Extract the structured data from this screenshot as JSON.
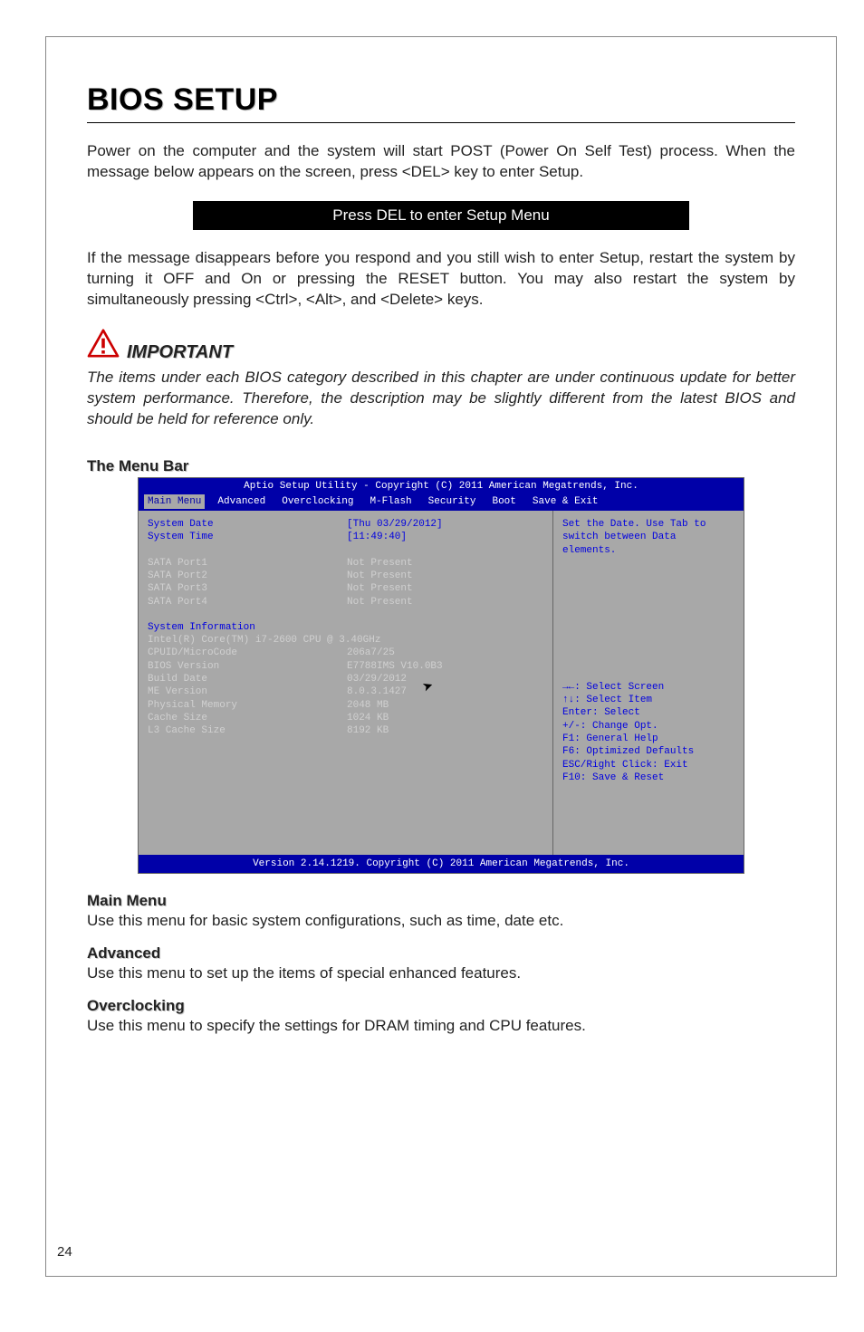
{
  "title": "BIOS SETUP",
  "intro1": "Power on the computer and the system will start POST (Power On Self Test) process. When the message below appears on the screen, press <DEL> key to enter Setup.",
  "delmsg": "Press DEL to enter Setup Menu",
  "intro2": "If the message disappears before you respond and you still wish to enter Setup, restart the system by turning it OFF and On or pressing the RESET button. You may also restart the system by simultaneously pressing <Ctrl>, <Alt>, and <Delete> keys.",
  "important_label": "IMPORTANT",
  "important_text": "The items under each BIOS category described in this chapter are under continuous update for better system performance. Therefore, the description may be slightly different from the latest BIOS and should be held for reference only.",
  "menu_bar_heading": "The Menu Bar",
  "bios": {
    "header_line": "Aptio Setup Utility - Copyright (C) 2011 American Megatrends, Inc.",
    "tabs": [
      "Main Menu",
      "Advanced",
      "Overclocking",
      "M-Flash",
      "Security",
      "Boot",
      "Save & Exit"
    ],
    "rows_top": [
      {
        "label": "System Date",
        "value": "[Thu 03/29/2012]",
        "sel": true
      },
      {
        "label": "System Time",
        "value": "[11:49:40]",
        "sel": true
      }
    ],
    "rows_sata": [
      {
        "label": "SATA Port1",
        "value": "Not Present"
      },
      {
        "label": "SATA Port2",
        "value": "Not Present"
      },
      {
        "label": "SATA Port3",
        "value": "Not Present"
      },
      {
        "label": "SATA Port4",
        "value": "Not Present"
      }
    ],
    "sysinfo_heading": "System Information",
    "cpu_line": "Intel(R) Core(TM) i7-2600 CPU @ 3.40GHz",
    "rows_info": [
      {
        "label": "CPUID/MicroCode",
        "value": "206a7/25"
      },
      {
        "label": "BIOS Version",
        "value": "E7788IMS V10.0B3"
      },
      {
        "label": "Build Date",
        "value": "03/29/2012"
      },
      {
        "label": "ME Version",
        "value": "8.0.3.1427"
      },
      {
        "label": "Physical Memory",
        "value": "2048 MB"
      },
      {
        "label": "Cache Size",
        "value": "1024 KB"
      },
      {
        "label": "L3 Cache Size",
        "value": "8192 KB"
      }
    ],
    "help_top": "Set the Date. Use Tab to switch between Data elements.",
    "help_keys": [
      "→←: Select Screen",
      "↑↓: Select Item",
      "Enter: Select",
      "+/-: Change Opt.",
      "F1: General Help",
      "F6: Optimized Defaults",
      "ESC/Right Click: Exit",
      "F10: Save & Reset"
    ],
    "footer": "Version 2.14.1219. Copyright (C) 2011 American Megatrends, Inc."
  },
  "sections": [
    {
      "heading": "Main Menu",
      "body": "Use this menu for basic system configurations, such as time, date etc."
    },
    {
      "heading": "Advanced",
      "body": "Use this menu to set up the items of special enhanced features."
    },
    {
      "heading": "Overclocking",
      "body": "Use this menu to specify the settings for DRAM timing and CPU features."
    }
  ],
  "page_number": "24"
}
